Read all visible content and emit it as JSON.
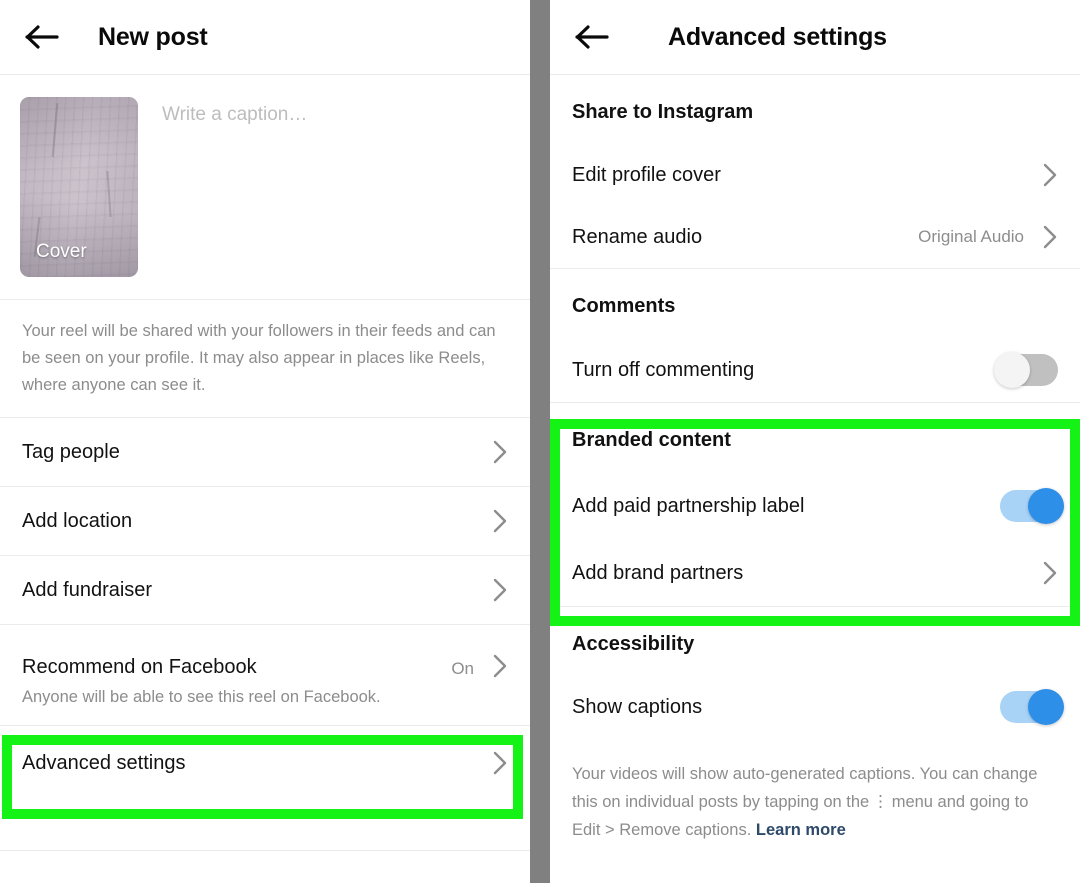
{
  "left_panel": {
    "header": {
      "back_icon": "back-arrow-icon",
      "title": "New post"
    },
    "compose": {
      "cover_label": "Cover",
      "caption_placeholder": "Write a caption…"
    },
    "info_text": "Your reel will be shared with your followers in their feeds and can be seen on your profile. It may also appear in places like Reels, where anyone can see it.",
    "rows": [
      {
        "label": "Tag people",
        "value": "",
        "chevron": true
      },
      {
        "label": "Add location",
        "value": "",
        "chevron": true
      },
      {
        "label": "Add fundraiser",
        "value": "",
        "chevron": true
      }
    ],
    "recommend_row": {
      "label": "Recommend on Facebook",
      "value": "On",
      "sub": "Anyone will be able to see this reel on Facebook."
    },
    "advanced_row": {
      "label": "Advanced settings",
      "highlighted": true
    }
  },
  "right_panel": {
    "header": {
      "back_icon": "back-arrow-icon",
      "title": "Advanced settings"
    },
    "share_section": {
      "title": "Share to Instagram",
      "rows": [
        {
          "label": "Edit profile cover",
          "value": ""
        },
        {
          "label": "Rename audio",
          "value": "Original Audio"
        }
      ]
    },
    "comments_section": {
      "title": "Comments",
      "toggle_label": "Turn off commenting",
      "toggle_state": "off"
    },
    "branded_section": {
      "title": "Branded content",
      "toggle_label": "Add paid partnership label",
      "toggle_state": "on",
      "partners_label": "Add brand partners",
      "highlighted": true
    },
    "accessibility_section": {
      "title": "Accessibility",
      "toggle_label": "Show captions",
      "toggle_state": "on",
      "note_part1": "Your videos will show auto-generated captions. You can change this on individual posts by tapping on the",
      "note_kebab": "⋮",
      "note_part2": "menu and going to Edit > Remove captions.",
      "learn_more": "Learn more"
    }
  },
  "colors": {
    "highlight": "#15f215",
    "toggle_on_track": "#a8d3f7",
    "toggle_on_knob": "#2e8fe8",
    "toggle_off_track": "#c0c0c0",
    "divider": "#808080",
    "link": "#2d4a6b"
  }
}
